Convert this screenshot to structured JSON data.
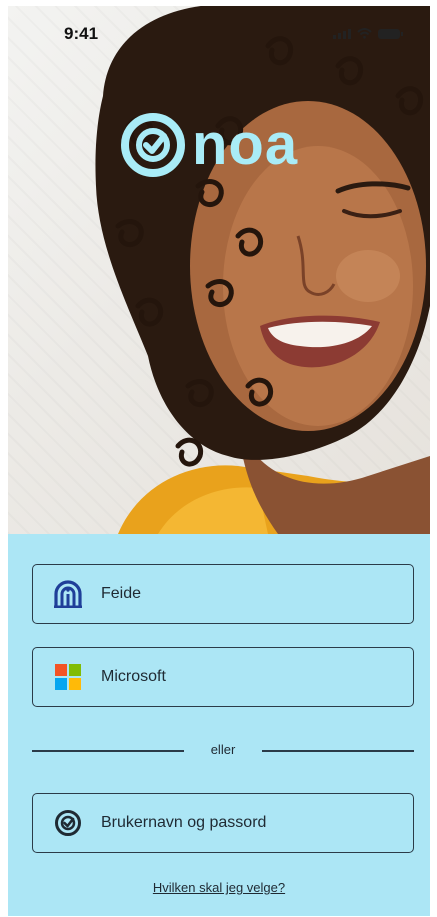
{
  "status_bar": {
    "time": "9:41"
  },
  "brand": {
    "name": "noa",
    "logo_color": "#a9ecf7"
  },
  "login": {
    "feide_label": "Feide",
    "microsoft_label": "Microsoft",
    "divider_text": "eller",
    "username_label": "Brukernavn og passord",
    "help_link": "Hvilken skal jeg velge?"
  },
  "icons": {
    "feide": "feide-icon",
    "microsoft": "microsoft-icon",
    "noa_check": "noa-check-icon",
    "signal": "signal-icon",
    "wifi": "wifi-icon",
    "battery": "battery-icon"
  },
  "colors": {
    "panel_bg": "#ace6f5",
    "button_border": "#2b3b48",
    "feide_blue": "#1f3f99",
    "ms_red": "#f35325",
    "ms_green": "#81bc06",
    "ms_blue": "#05a6f0",
    "ms_yellow": "#ffba08"
  }
}
